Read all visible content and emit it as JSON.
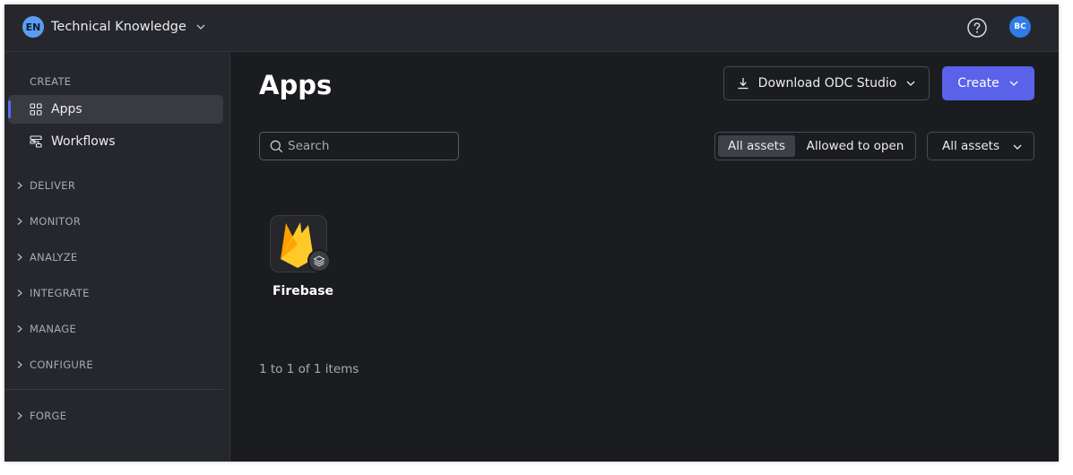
{
  "header": {
    "org_initials": "EN",
    "org_name": "Technical Knowledge",
    "user_initials": "BC"
  },
  "sidebar": {
    "create_section": "CREATE",
    "items": [
      {
        "label": "Apps",
        "icon": "grid-icon",
        "active": true
      },
      {
        "label": "Workflows",
        "icon": "workflow-icon",
        "active": false
      }
    ],
    "sections": [
      "DELIVER",
      "MONITOR",
      "ANALYZE",
      "INTEGRATE",
      "MANAGE",
      "CONFIGURE"
    ],
    "footer_section": "FORGE"
  },
  "main": {
    "title": "Apps",
    "download_button": "Download ODC Studio",
    "create_button": "Create",
    "search": {
      "placeholder": "Search",
      "value": ""
    },
    "segmented": {
      "options": [
        "All assets",
        "Allowed to open"
      ],
      "selected": "All assets"
    },
    "filter": {
      "selected": "All assets"
    },
    "apps": [
      {
        "name": "Firebase",
        "icon": "firebase-logo-icon",
        "badge": "layers-icon"
      }
    ],
    "pagination": "1 to 1 of 1 items"
  },
  "colors": {
    "background": "#1b1c20",
    "panel": "#26272c",
    "accent": "#5a62ea",
    "active_indicator": "#5a6cf0",
    "org_avatar": "#5b9ef0",
    "user_avatar": "#2f7be8"
  }
}
